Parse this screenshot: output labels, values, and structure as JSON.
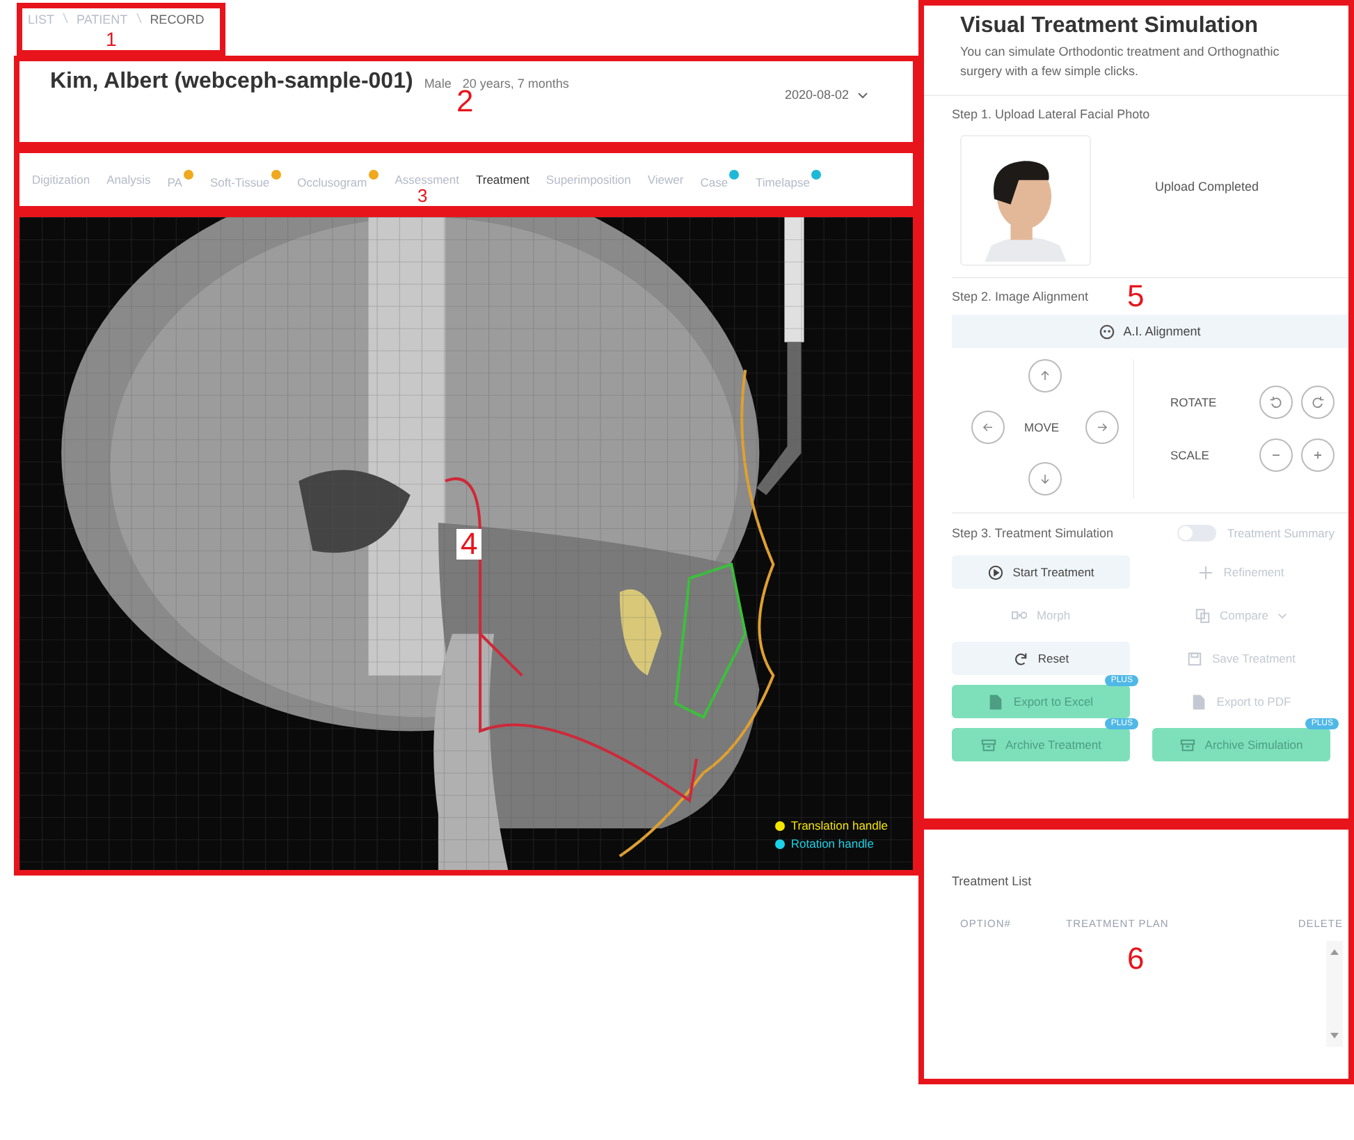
{
  "breadcrumb": {
    "annotation": "1",
    "items": [
      {
        "label": "LIST",
        "selected": false
      },
      {
        "label": "PATIENT",
        "selected": false
      },
      {
        "label": "RECORD",
        "selected": true
      }
    ]
  },
  "patient": {
    "annotation": "2",
    "name": "Kim, Albert (webceph-sample-001)",
    "sex": "Male",
    "age": "20 years, 7 months",
    "date": "2020-08-02"
  },
  "tabs": {
    "annotation": "3",
    "items": [
      {
        "label": "Digitization",
        "selected": false
      },
      {
        "label": "Analysis",
        "selected": false
      },
      {
        "label": "PA",
        "selected": false,
        "color": "#f0a81c"
      },
      {
        "label": "Soft-Tissue",
        "selected": false,
        "color": "#f0a81c"
      },
      {
        "label": "Occlusogram",
        "selected": false,
        "color": "#f0a81c"
      },
      {
        "label": "Assessment",
        "selected": false
      },
      {
        "label": "Treatment",
        "selected": true
      },
      {
        "label": "Superimposition",
        "selected": false
      },
      {
        "label": "Viewer",
        "selected": false
      },
      {
        "label": "Case",
        "selected": false,
        "color": "#1cb8d8"
      },
      {
        "label": "Timelapse",
        "selected": false,
        "color": "#1cb8d8"
      }
    ]
  },
  "xray": {
    "annotation": "4",
    "kind": "picture",
    "legend": [
      {
        "label": "Translation handle",
        "color": "#f5e400"
      },
      {
        "label": "Rotation handle",
        "color": "#19d3e8"
      }
    ]
  },
  "simulation": {
    "annotation": "5",
    "title": "Visual Treatment Simulation",
    "description": "You can simulate Orthodontic treatment and Orthognathic surgery with a few simple clicks.",
    "step1": {
      "heading": "Step 1. Upload Lateral Facial Photo",
      "status": "Upload Completed"
    },
    "step2": {
      "heading": "Step 2. Image Alignment",
      "ai_button": "A.I. Alignment",
      "move_label": "MOVE",
      "rotate_label": "ROTATE",
      "scale_label": "SCALE"
    },
    "step3": {
      "heading": "Step 3. Treatment Simulation",
      "summary_toggle": {
        "label": "Treatment Summary",
        "on": false
      },
      "buttons": [
        {
          "label": "Start Treatment",
          "kind": "start",
          "disabled": false
        },
        {
          "label": "Refinement",
          "kind": "refine",
          "disabled": true
        },
        {
          "label": "Morph",
          "kind": "morph",
          "disabled": true
        },
        {
          "label": "Compare",
          "kind": "compare",
          "disabled": true
        },
        {
          "label": "Reset",
          "kind": "reset",
          "disabled": false
        },
        {
          "label": "Save Treatment",
          "kind": "save",
          "disabled": true
        },
        {
          "label": "Export to Excel",
          "kind": "export",
          "disabled": true,
          "badge": "PLUS"
        },
        {
          "label": "Export to PDF",
          "kind": "export",
          "disabled": true
        },
        {
          "label": "Archive Treatment",
          "kind": "archive",
          "disabled": true,
          "badge": "PLUS"
        },
        {
          "label": "Archive Simulation",
          "kind": "archive",
          "disabled": true,
          "badge": "PLUS"
        }
      ]
    }
  },
  "treatment_list": {
    "annotation": "6",
    "title": "Treatment List",
    "columns": [
      "OPTION#",
      "TREATMENT PLAN",
      "DELETE"
    ]
  }
}
